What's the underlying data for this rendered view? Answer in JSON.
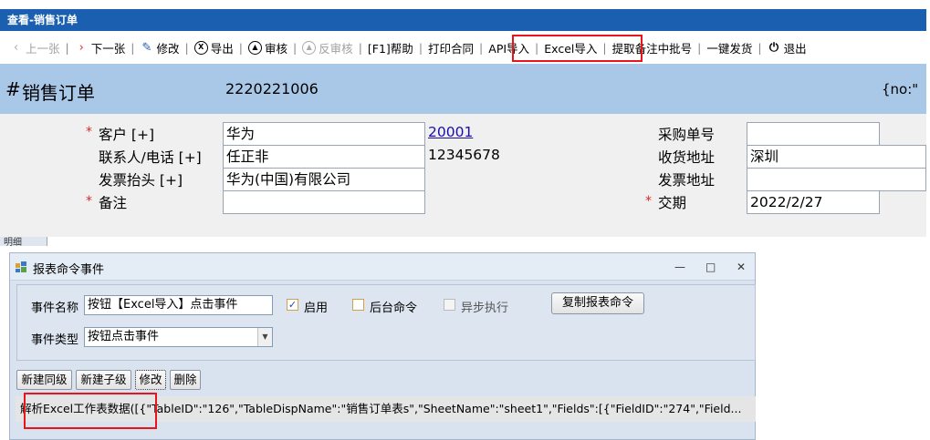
{
  "window": {
    "title": "查看-销售订单"
  },
  "toolbar": {
    "prev": "上一张",
    "next": "下一张",
    "edit": "修改",
    "export": "导出",
    "audit": "审核",
    "unaudit": "反审核",
    "help": "[F1]帮助",
    "print_contract": "打印合同",
    "api_import": "API导入",
    "excel_import": "Excel导入",
    "fetch_batch": "提取备注中批号",
    "one_click_ship": "一键发货",
    "exit": "退出"
  },
  "header": {
    "hash": "#",
    "title": "销售订单",
    "order_no": "2220221006",
    "right_text": "{no:\""
  },
  "form": {
    "customer_label": "客户 [+]",
    "customer_value": "华为",
    "customer_code": "20001",
    "contact_label": "联系人/电话 [+]",
    "contact_value": "任正非",
    "phone_value": "12345678",
    "invoice_label": "发票抬头 [+]",
    "invoice_value": "华为(中国)有限公司",
    "remark_label": "备注",
    "remark_value": "",
    "po_label": "采购单号",
    "po_value": "",
    "ship_addr_label": "收货地址",
    "ship_addr_value": "深圳",
    "invoice_addr_label": "发票地址",
    "invoice_addr_value": "",
    "delivery_label": "交期",
    "delivery_value": "2022/2/27",
    "required_mark": "*"
  },
  "detail_tab": {
    "label": "明细"
  },
  "dialog": {
    "title": "报表命令事件",
    "event_name_label": "事件名称",
    "event_name_value": "按钮【Excel导入】点击事件",
    "enable_label": "启用",
    "backend_label": "后台命令",
    "async_label": "异步执行",
    "copy_button": "复制报表命令",
    "event_type_label": "事件类型",
    "event_type_value": "按钮点击事件",
    "new_sibling": "新建同级",
    "new_child": "新建子级",
    "modify": "修改",
    "delete": "删除",
    "command_text": "解析Excel工作表数据([{\"TableID\":\"126\",\"TableDispName\":\"销售订单表s\",\"SheetName\":\"sheet1\",\"Fields\":[{\"FieldID\":\"274\",\"Field..."
  }
}
